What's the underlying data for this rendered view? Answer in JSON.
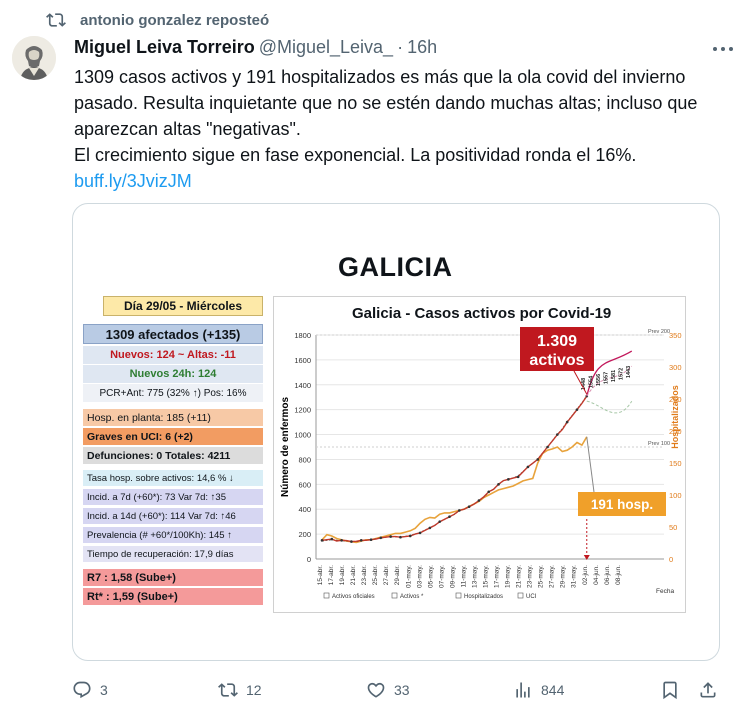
{
  "repost": {
    "icon": "repost-icon",
    "text": "antonio gonzalez reposteó"
  },
  "tweet": {
    "author_name": "Miguel Leiva Torreiro",
    "author_handle": "@Miguel_Leiva_",
    "separator": "·",
    "time": "16h",
    "text_lines": [
      "1309 casos activos y 191 hospitalizados es más que la ola covid del invierno",
      "pasado. Resulta inquietante que no se estén dando muchas altas; incluso que",
      "aparezcan altas \"negativas\".",
      "El crecimiento sigue en fase exponencial. La positividad ronda el 16%."
    ],
    "link": "buff.ly/3JvizJM"
  },
  "media": {
    "title": "GALICIA",
    "panel": {
      "day": "Día 29/05 - Miércoles",
      "afectados": "1309 afectados (+135)",
      "nuevos_altas": "Nuevos:  124  ~ Altas:  -11",
      "nuevos_24h": "Nuevos 24h:  124",
      "pcr": "PCR+Ant: 775  (32% ↑)  Pos: 16%",
      "hosp_planta": "Hosp. en planta:  185 (+11)",
      "graves_uci": "Graves en UCI:     6 (+2)",
      "defunciones": "Defunciones: 0     Totales: 4211",
      "tasa_hosp": "Tasa hosp. sobre activos:  14,6 %  ↓",
      "incid_7d": "Incid. a 7d (+60*):  73  Var 7d:  ↑35",
      "incid_14d": "Incid. a 14d (+60*): 114  Var 7d:  ↑46",
      "prevalencia": "Prevalencia (# +60*/100Kh):  145 ↑",
      "recuperacion": "Tiempo de recuperación: 17,9 días",
      "r7": "R7 :  1,58 (Sube+)",
      "rt": "Rt* :  1,59 (Sube+)"
    },
    "colors": {
      "activos": "#c0392b",
      "hosp": "#e8a33c",
      "callout_red": "#c0181f",
      "callout_orange": "#f0a02a"
    }
  },
  "chart_data": {
    "type": "line",
    "title": "Galicia  -  Casos activos por Covid-19",
    "ylabel": "Número de enfermos",
    "y2label": "Hospitalizados",
    "xlabel": "Fecha",
    "ylim": [
      0,
      1800
    ],
    "y2lim": [
      0,
      350
    ],
    "yticks": [
      0,
      200,
      400,
      600,
      800,
      1000,
      1200,
      1400,
      1600,
      1800
    ],
    "y2ticks": [
      0,
      50,
      100,
      150,
      200,
      250,
      300,
      350
    ],
    "x_tick_labels": [
      "15-abr.",
      "17-abr.",
      "19-abr.",
      "21-abr.",
      "23-abr.",
      "25-abr.",
      "27-abr.",
      "29-abr.",
      "01-may.",
      "03-may.",
      "05-may.",
      "07-may.",
      "09-may.",
      "11-may.",
      "13-may.",
      "15-may.",
      "17-may.",
      "19-may.",
      "21-may.",
      "23-may.",
      "25-may.",
      "27-may.",
      "29-may.",
      "31-may.",
      "02-jun.",
      "04-jun.",
      "06-jun.",
      "08-jun."
    ],
    "series": [
      {
        "name": "Activos oficiales",
        "color": "#c0392b",
        "values": [
          150,
          155,
          160,
          145,
          150,
          148,
          140,
          142,
          150,
          150,
          155,
          160,
          170,
          175,
          180,
          180,
          175,
          180,
          185,
          200,
          210,
          230,
          250,
          270,
          300,
          320,
          340,
          360,
          390,
          400,
          420,
          440,
          470,
          500,
          540,
          560,
          600,
          630,
          640,
          650,
          660,
          700,
          740,
          770,
          800,
          850,
          900,
          950,
          1000,
          1040,
          1100,
          1150,
          1200,
          1250,
          1309
        ]
      },
      {
        "name": "Activos *",
        "color": "#333333",
        "values": [
          145,
          150,
          155,
          150,
          148,
          145,
          142,
          140,
          148,
          152,
          156,
          162,
          168,
          174,
          180,
          178,
          176,
          182,
          190,
          202,
          214,
          232,
          252,
          272,
          298,
          318,
          338,
          358,
          388,
          402,
          420,
          442,
          468,
          498,
          536,
          562,
          598,
          628,
          642,
          652,
          668,
          702,
          742,
          768,
          802,
          852,
          902,
          952,
          1002,
          1046,
          1104,
          1152,
          1204,
          1254,
          1312
        ]
      },
      {
        "name": "Hospitalizados",
        "color": "#e8a33c",
        "axis": "right",
        "values": [
          30,
          38,
          36,
          32,
          30,
          28,
          27,
          26,
          28,
          30,
          30,
          32,
          34,
          36,
          38,
          40,
          40,
          42,
          44,
          48,
          56,
          62,
          65,
          64,
          70,
          72,
          72,
          74,
          76,
          78,
          82,
          86,
          90,
          96,
          100,
          104,
          108,
          110,
          112,
          114,
          118,
          122,
          124,
          126,
          150,
          165,
          170,
          172,
          175,
          168,
          170,
          175,
          182,
          178,
          191
        ]
      },
      {
        "name": "UCI",
        "color": "#999999",
        "values": []
      }
    ],
    "point_labels": [
      "1448",
      "1554",
      "1556",
      "1557",
      "1581",
      "1572",
      "1443"
    ],
    "reference_labels": [
      "Prev 200",
      "Prev 100"
    ],
    "annotations": [
      {
        "text_lines": [
          "1.309",
          "activos"
        ]
      },
      {
        "text": "191 hosp."
      }
    ],
    "legend": [
      "Activos oficiales",
      "Activos *",
      "Hospitalizados",
      "UCI"
    ]
  },
  "actions": {
    "reply_count": "3",
    "repost_count": "12",
    "like_count": "33",
    "views_count": "844"
  }
}
